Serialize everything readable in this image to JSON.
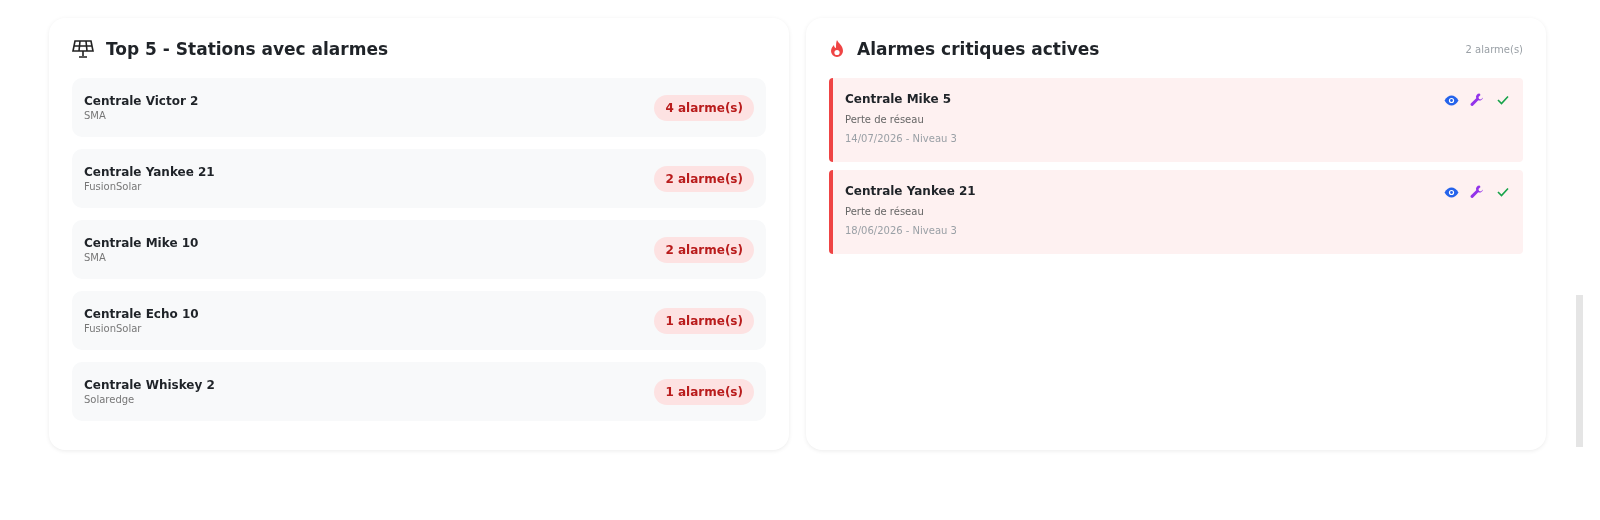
{
  "top_stations": {
    "title": "Top 5 - Stations avec alarmes",
    "items": [
      {
        "name": "Centrale Victor 2",
        "vendor": "SMA",
        "badge": "4 alarme(s)"
      },
      {
        "name": "Centrale Yankee 21",
        "vendor": "FusionSolar",
        "badge": "2 alarme(s)"
      },
      {
        "name": "Centrale Mike 10",
        "vendor": "SMA",
        "badge": "2 alarme(s)"
      },
      {
        "name": "Centrale Echo 10",
        "vendor": "FusionSolar",
        "badge": "1 alarme(s)"
      },
      {
        "name": "Centrale Whiskey 2",
        "vendor": "Solaredge",
        "badge": "1 alarme(s)"
      }
    ]
  },
  "critical_alarms": {
    "title": "Alarmes critiques actives",
    "count": "2 alarme(s)",
    "items": [
      {
        "station": "Centrale Mike 5",
        "message": "Perte de réseau",
        "meta": "14/07/2026 - Niveau 3"
      },
      {
        "station": "Centrale Yankee 21",
        "message": "Perte de réseau",
        "meta": "18/06/2026 - Niveau 3"
      }
    ]
  }
}
